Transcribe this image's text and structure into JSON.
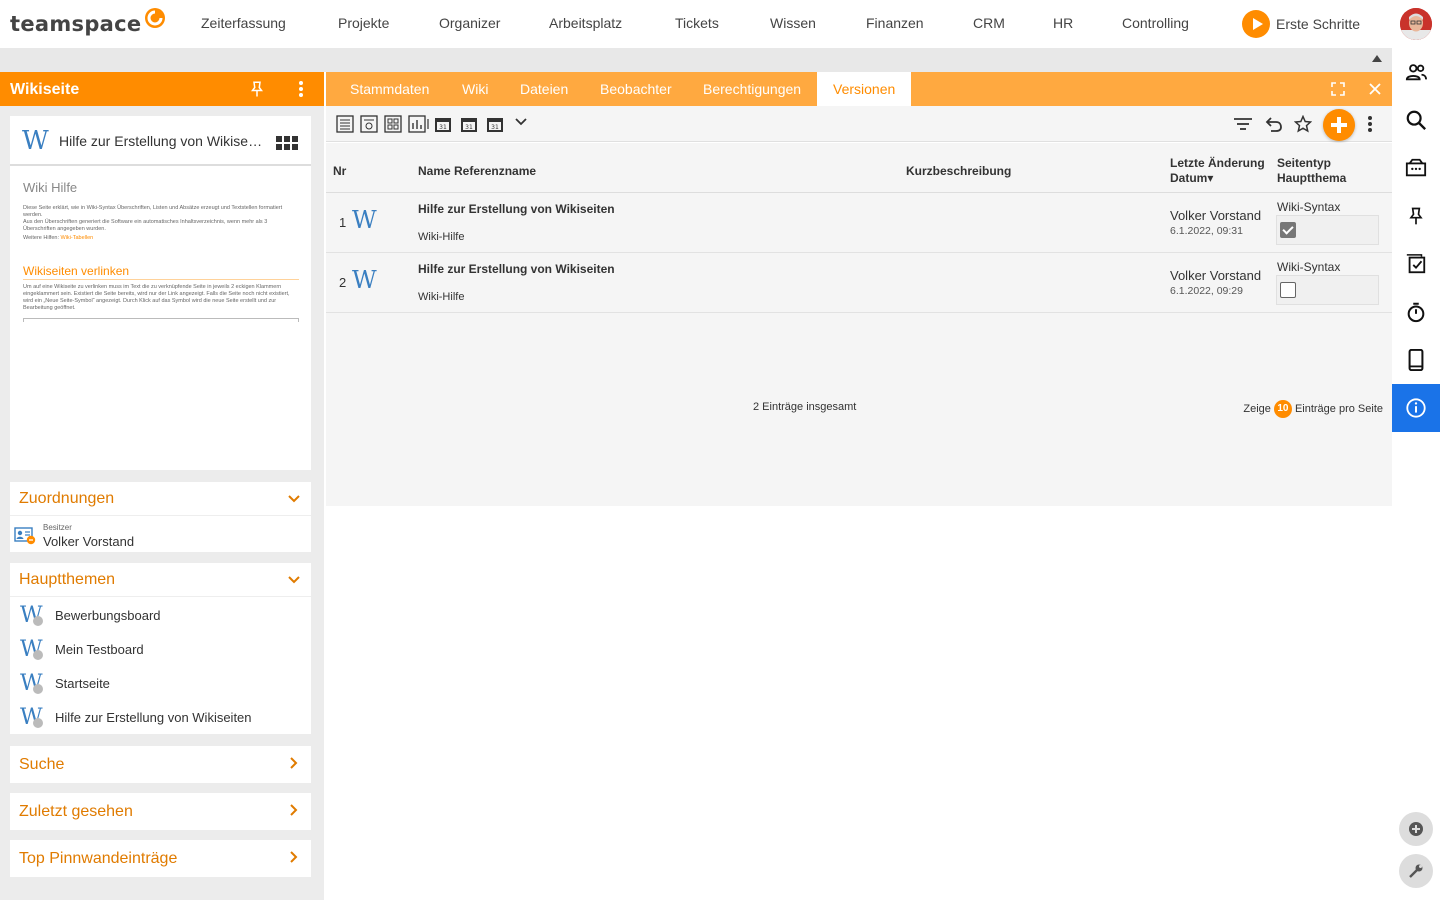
{
  "app": {
    "logo": "teamspace"
  },
  "topnav": {
    "items": [
      "Zeiterfassung",
      "Projekte",
      "Organizer",
      "Arbeitsplatz",
      "Tickets",
      "Wissen",
      "Finanzen",
      "CRM",
      "HR",
      "Controlling"
    ],
    "erste_schritte": "Erste Schritte"
  },
  "left": {
    "title": "Wikiseite",
    "preview": {
      "title": "Hilfe zur Erstellung von Wikiseiten",
      "doc_heading": "Wiki Hilfe",
      "doc_para1": "Diese Seite erklärt, wie in Wiki-Syntax Überschriften, Listen und Absätze erzeugt und Textstellen formatiert werden.",
      "doc_para2": "Aus den Überschriften generiert die Software ein automatisches Inhaltsverzeichnis, wenn mehr als 3 Überschriften angegeben wurden.",
      "doc_more_label": "Weitere Hilfen:",
      "doc_more_link": "Wiki-Tabellen",
      "doc_heading2": "Wikiseiten verlinken",
      "doc_para3": "Um auf eine Wikiseite zu verlinken muss im Text die zu verknüpfende Seite in jeweils 2 eckigen Klammern eingeklammert sein. Existiert die Seite bereits, wird nur der Link angezeigt. Falls die Seite noch nicht existiert, wird ein „Neue Seite-Symbol“ angezeigt. Durch Klick auf das Symbol wird die neue Seite erstellt und zur Bearbeitung geöffnet."
    },
    "zuordnungen": {
      "title": "Zuordnungen",
      "label": "Besitzer",
      "value": "Volker Vorstand"
    },
    "hauptthemen": {
      "title": "Hauptthemen",
      "items": [
        "Bewerbungsboard",
        "Mein Testboard",
        "Startseite",
        "Hilfe zur Erstellung von Wikiseiten"
      ]
    },
    "suche": "Suche",
    "zuletzt": "Zuletzt gesehen",
    "top_pinnwand": "Top Pinnwandeinträge"
  },
  "tabs": [
    "Stammdaten",
    "Wiki",
    "Dateien",
    "Beobachter",
    "Berechtigungen",
    "Versionen"
  ],
  "active_tab": "Versionen",
  "table": {
    "headers": {
      "nr": "Nr",
      "name": "Name Referenzname",
      "desc": "Kurzbeschreibung",
      "changed": "Letzte Änderung",
      "changed_sub": "Datum▾",
      "type": "Seitentyp",
      "type_sub": "Hauptthema"
    },
    "rows": [
      {
        "nr": "1",
        "w": "W",
        "name": "Hilfe zur Erstellung von Wikiseiten",
        "ref": "Wiki-Hilfe",
        "user": "Volker Vorstand",
        "date": "6.1.2022, 09:31",
        "type": "Wiki-Syntax",
        "hauptthema": true
      },
      {
        "nr": "2",
        "w": "W",
        "name": "Hilfe zur Erstellung von Wikiseiten",
        "ref": "Wiki-Hilfe",
        "user": "Volker Vorstand",
        "date": "6.1.2022, 09:29",
        "type": "Wiki-Syntax",
        "hauptthema": false
      }
    ],
    "total": "2 Einträge insgesamt",
    "show_label": "Zeige",
    "per_page": "10",
    "per_page_label": "Einträge pro Seite"
  },
  "colors": {
    "accent": "#ff8c00",
    "tabbar": "#ffa940",
    "wiki_blue": "#3a7fc1",
    "info_blue": "#1a73e8"
  }
}
